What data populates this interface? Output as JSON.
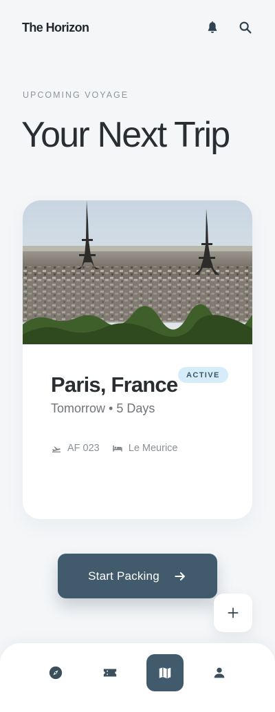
{
  "app": {
    "title": "The Horizon"
  },
  "header": {
    "eyebrow": "UPCOMING VOYAGE",
    "title": "Your Next Trip",
    "icons": [
      "bell-icon",
      "search-icon"
    ]
  },
  "trip": {
    "city": "Paris, France",
    "status": "ACTIVE",
    "when": "Tomorrow • 5 Days",
    "flight": "AF 023",
    "hotel": "Le Meurice",
    "image": "eiffel-tower-photo"
  },
  "actions": {
    "primary": "Start Packing",
    "fab_icon": "plus-icon"
  },
  "nav": {
    "items": [
      "explore",
      "tickets",
      "map",
      "profile"
    ],
    "active": "map"
  },
  "colors": {
    "background": "#f4f6f8",
    "accent": "#415b6c",
    "badge_bg": "#d6ecf8",
    "text": "#2a2e32"
  }
}
